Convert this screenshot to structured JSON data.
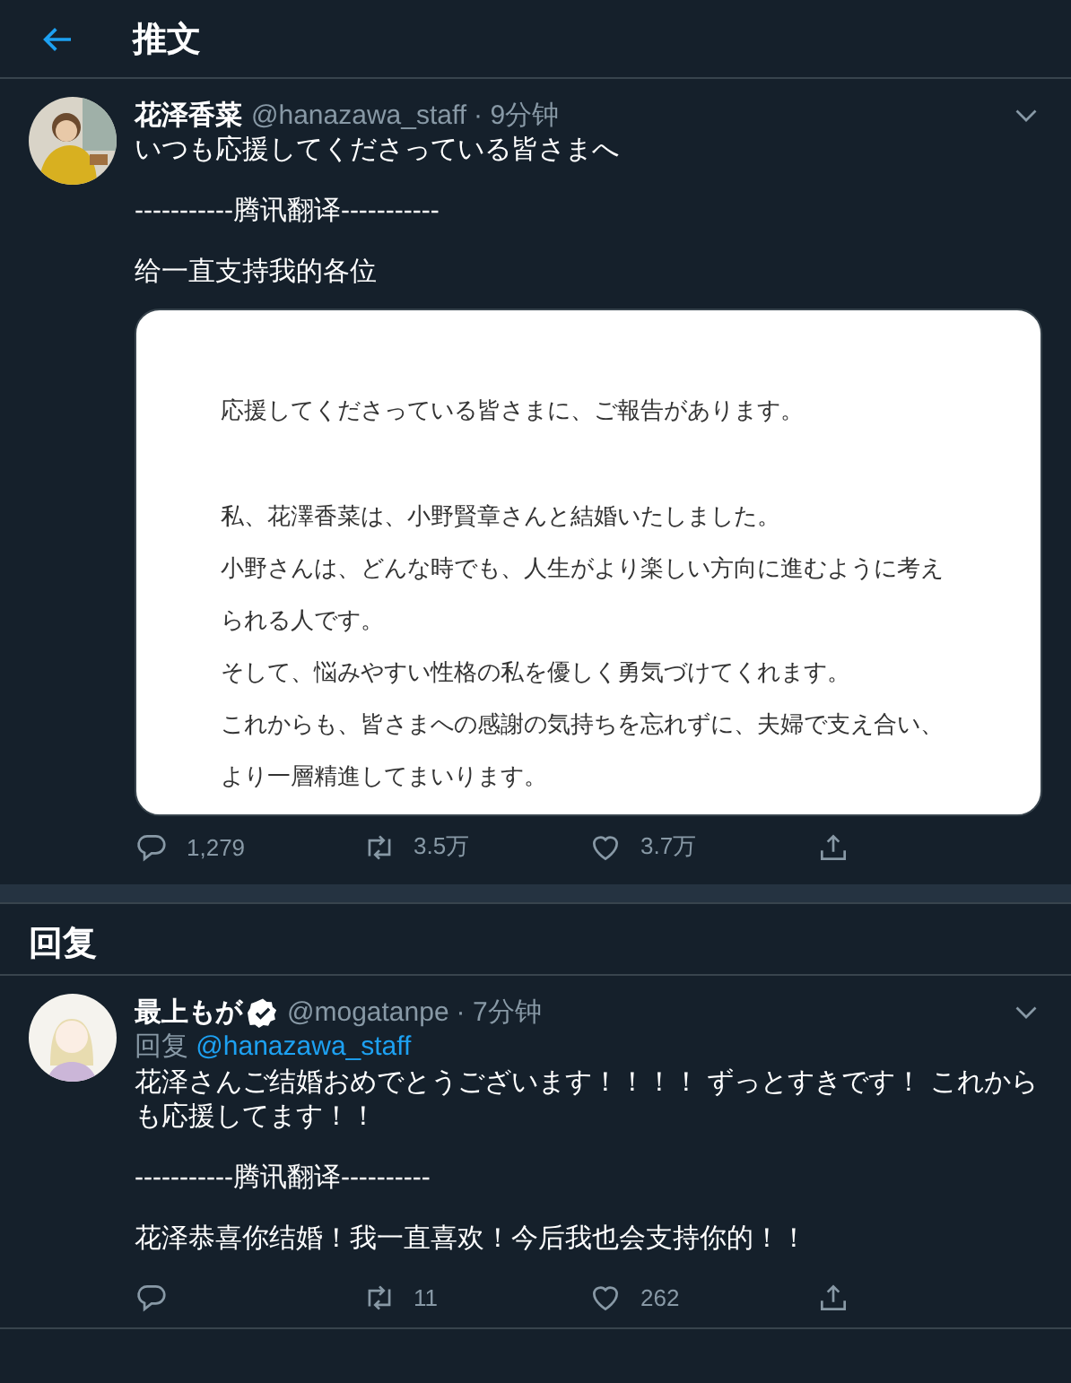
{
  "header": {
    "title": "推文"
  },
  "tweet": {
    "name": "花泽香菜",
    "handle": "@hanazawa_staff",
    "time": "· 9分钟",
    "paragraphs": [
      "いつも応援してくださっている皆さまへ",
      "-----------腾讯翻译-----------",
      "给一直支持我的各位"
    ],
    "document": {
      "paragraphs": [
        [
          "応援してくださっている皆さまに、ご報告があります。"
        ],
        [
          "私、花澤香菜は、小野賢章さんと結婚いたしました。",
          "小野さんは、どんな時でも、人生がより楽しい方向に進むように考え",
          "られる人です。",
          "そして、悩みやすい性格の私を優しく勇気づけてくれます。",
          "これからも、皆さまへの感謝の気持ちを忘れずに、夫婦で支え合い、",
          "より一層精進してまいります。"
        ]
      ]
    },
    "actions": [
      {
        "kind": "reply",
        "count": "1,279"
      },
      {
        "kind": "retweet",
        "count": "3.5万"
      },
      {
        "kind": "like",
        "count": "3.7万"
      },
      {
        "kind": "share"
      }
    ]
  },
  "replies_heading": "回复",
  "reply": {
    "name": "最上もが",
    "verified": true,
    "handle": "@mogatanpe",
    "time": "· 7分钟",
    "reply_label": "回复",
    "reply_to": "@hanazawa_staff",
    "paragraphs": [
      "花泽さんご结婚おめでとうございます！！！！ ずっとすきです！ これからも応援してます！！",
      "-----------腾讯翻译----------",
      "花泽恭喜你结婚！我一直喜欢！今后我也会支持你的！！"
    ],
    "actions": [
      {
        "kind": "reply"
      },
      {
        "kind": "retweet",
        "count": "11"
      },
      {
        "kind": "like",
        "count": "262"
      },
      {
        "kind": "share"
      }
    ]
  }
}
